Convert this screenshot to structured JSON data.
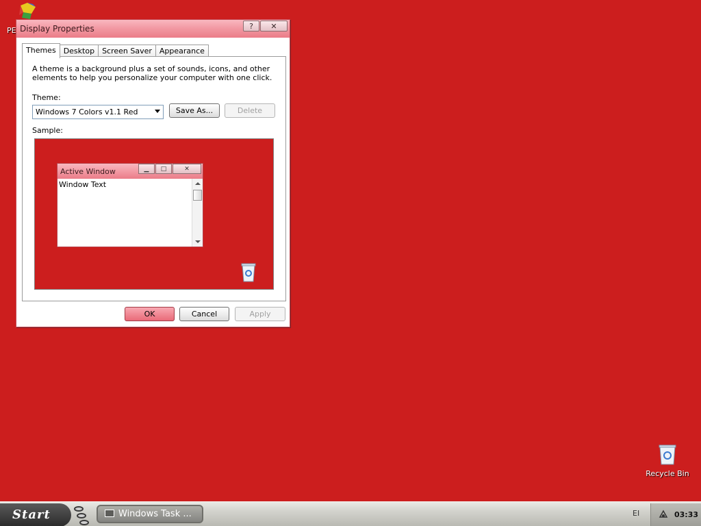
{
  "desktop": {
    "top_icon_label": "PE",
    "recycle_bin_label": "Recycle Bin"
  },
  "dialog": {
    "title": "Display Properties",
    "help_symbol": "?",
    "close_symbol": "✕",
    "tabs": [
      {
        "label": "Themes",
        "active": true
      },
      {
        "label": "Desktop",
        "active": false
      },
      {
        "label": "Screen Saver",
        "active": false
      },
      {
        "label": "Appearance",
        "active": false
      }
    ],
    "description": "A theme is a background plus a set of sounds, icons, and other elements to help you personalize your computer with one click.",
    "theme_label": "Theme:",
    "theme_value": "Windows 7 Colors v1.1 Red",
    "save_as_label": "Save As...",
    "delete_label": "Delete",
    "sample_label": "Sample:",
    "sample": {
      "window_title": "Active Window",
      "window_text": "Window Text"
    },
    "ok_label": "OK",
    "cancel_label": "Cancel",
    "apply_label": "Apply"
  },
  "taskbar": {
    "start_label": "Start",
    "task_button_label": "Windows Task ...",
    "language_indicator": "EI",
    "clock": "03:33"
  },
  "colors": {
    "desktop_background": "#cc1e1e",
    "titlebar_accent": "#eb7c88"
  }
}
